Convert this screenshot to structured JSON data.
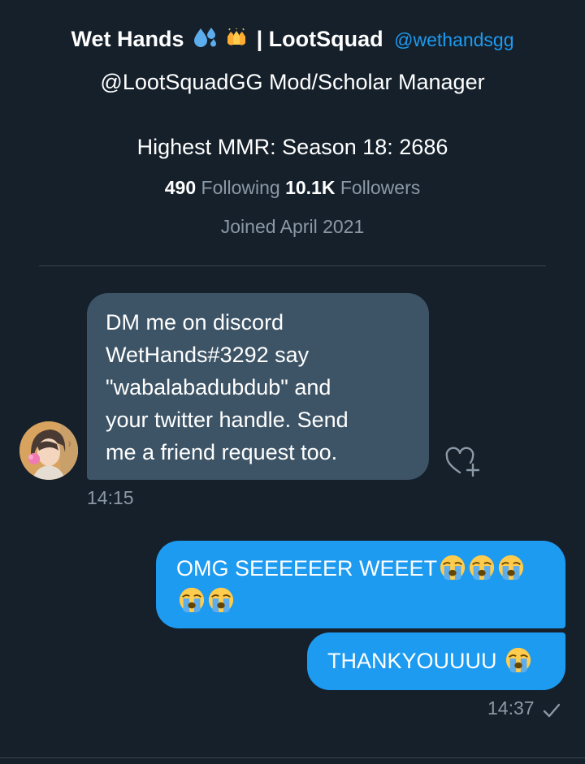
{
  "profile": {
    "display_name": "Wet Hands",
    "display_name_suffix": "| LootSquad",
    "emoji_names": [
      "sweat-droplets-emoji",
      "raised-hands-emoji"
    ],
    "handle": "@wethandsgg",
    "bio_line1": "@LootSquadGG Mod/Scholar Manager",
    "bio_line2": "Highest MMR: Season 18: 2686",
    "following_count": "490",
    "following_label": "Following",
    "followers_count": "10.1K",
    "followers_label": "Followers",
    "joined": "Joined April 2021"
  },
  "messages": [
    {
      "direction": "incoming",
      "lines": [
        "DM me on discord",
        "WetHands#3292 say",
        "\"wabalabadubdub\" and",
        "your twitter handle. Send",
        "me a friend request too."
      ],
      "time": "14:15"
    },
    {
      "direction": "outgoing",
      "line1": "OMG SEEEEEER WEEET",
      "emoji": "loudly-crying-face-emoji"
    },
    {
      "direction": "outgoing",
      "text": "THANKYOUUUU",
      "emoji": "loudly-crying-face-emoji",
      "time": "14:37"
    }
  ],
  "colors": {
    "background": "#15202b",
    "incoming_bubble": "#3d5466",
    "outgoing_bubble": "#1d9bf0",
    "secondary_text": "#8b98a5",
    "accent": "#1d9bf0"
  }
}
